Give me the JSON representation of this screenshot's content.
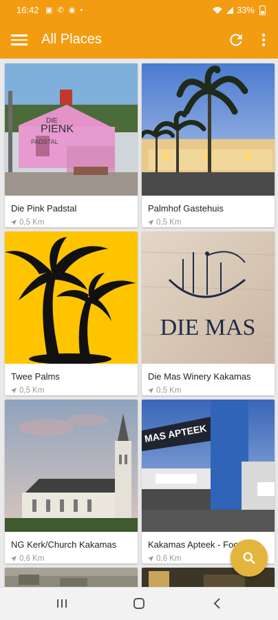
{
  "status_bar": {
    "time": "16:42",
    "battery": "33%"
  },
  "app_bar": {
    "title": "All Places"
  },
  "places": [
    {
      "name": "Die Pink Padstal",
      "distance": "0,5 Km"
    },
    {
      "name": "Palmhof Gastehuis",
      "distance": "0,5 Km"
    },
    {
      "name": "Twee Palms",
      "distance": "0,5 Km"
    },
    {
      "name": "Die Mas Winery Kakamas",
      "distance": "0,5 Km"
    },
    {
      "name": "NG Kerk/Church Kakamas",
      "distance": "0,6 Km"
    },
    {
      "name": "Kakamas Apteek - Food",
      "distance": "0,6 Km"
    }
  ],
  "image_text": {
    "padstal_sign_1": "DIE",
    "padstal_sign_2": "PIENK",
    "padstal_sign_3": "PADSTAL",
    "mas_logo": "DIE MAS",
    "apteek_sign": "MAS APTEEK"
  },
  "colors": {
    "app_bar": "#f39c12",
    "fab": "#e3b53c",
    "palm_yellow": "#ffc400"
  }
}
